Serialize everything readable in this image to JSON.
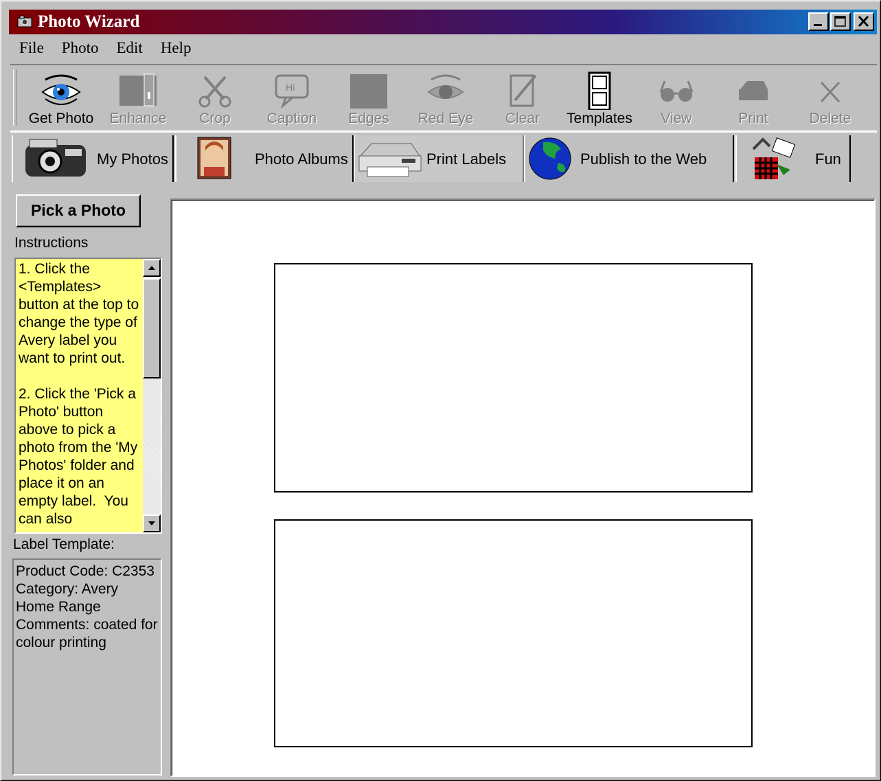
{
  "window": {
    "title": "Photo Wizard",
    "controls": [
      "minimize",
      "maximize",
      "close"
    ]
  },
  "menu": [
    "File",
    "Photo",
    "Edit",
    "Help"
  ],
  "toolbar": [
    {
      "label": "Get Photo",
      "icon": "eye-icon",
      "enabled": true
    },
    {
      "label": "Enhance",
      "icon": "enhance-icon",
      "enabled": false
    },
    {
      "label": "Crop",
      "icon": "scissors-icon",
      "enabled": false
    },
    {
      "label": "Caption",
      "icon": "speech-bubble-icon",
      "enabled": false
    },
    {
      "label": "Edges",
      "icon": "edges-icon",
      "enabled": false
    },
    {
      "label": "Red Eye",
      "icon": "red-eye-icon",
      "enabled": false
    },
    {
      "label": "Clear",
      "icon": "clear-icon",
      "enabled": false
    },
    {
      "label": "Templates",
      "icon": "templates-icon",
      "enabled": true
    },
    {
      "label": "View",
      "icon": "glasses-icon",
      "enabled": false
    },
    {
      "label": "Print",
      "icon": "printer-icon",
      "enabled": false
    },
    {
      "label": "Delete",
      "icon": "delete-icon",
      "enabled": false
    }
  ],
  "tabs": [
    {
      "label": "My Photos",
      "icon": "camera-icon",
      "active": false
    },
    {
      "label": "Photo Albums",
      "icon": "portrait-icon",
      "active": false
    },
    {
      "label": "Print Labels",
      "icon": "printer-icon",
      "active": true
    },
    {
      "label": "Publish to the Web",
      "icon": "globe-icon",
      "active": false
    },
    {
      "label": "Fun",
      "icon": "fun-icon",
      "active": false
    }
  ],
  "left_panel": {
    "pick_button": "Pick a Photo",
    "instructions_label": "Instructions",
    "instructions_text": "1. Click the <Templates> button at the top to change the type of Avery label you want to print out.\n\n2. Click the 'Pick a Photo' button above to pick a photo from the 'My Photos' folder and place it on an empty label.  You can also",
    "template_label": "Label Template:",
    "template_text": "Product Code: C2353\nCategory: Avery Home Range\nComments: coated for colour printing"
  },
  "colors": {
    "titlebar_start": "#800000",
    "titlebar_end": "#1084d0",
    "instructions_bg": "#ffff80",
    "face": "#c0c0c0"
  }
}
